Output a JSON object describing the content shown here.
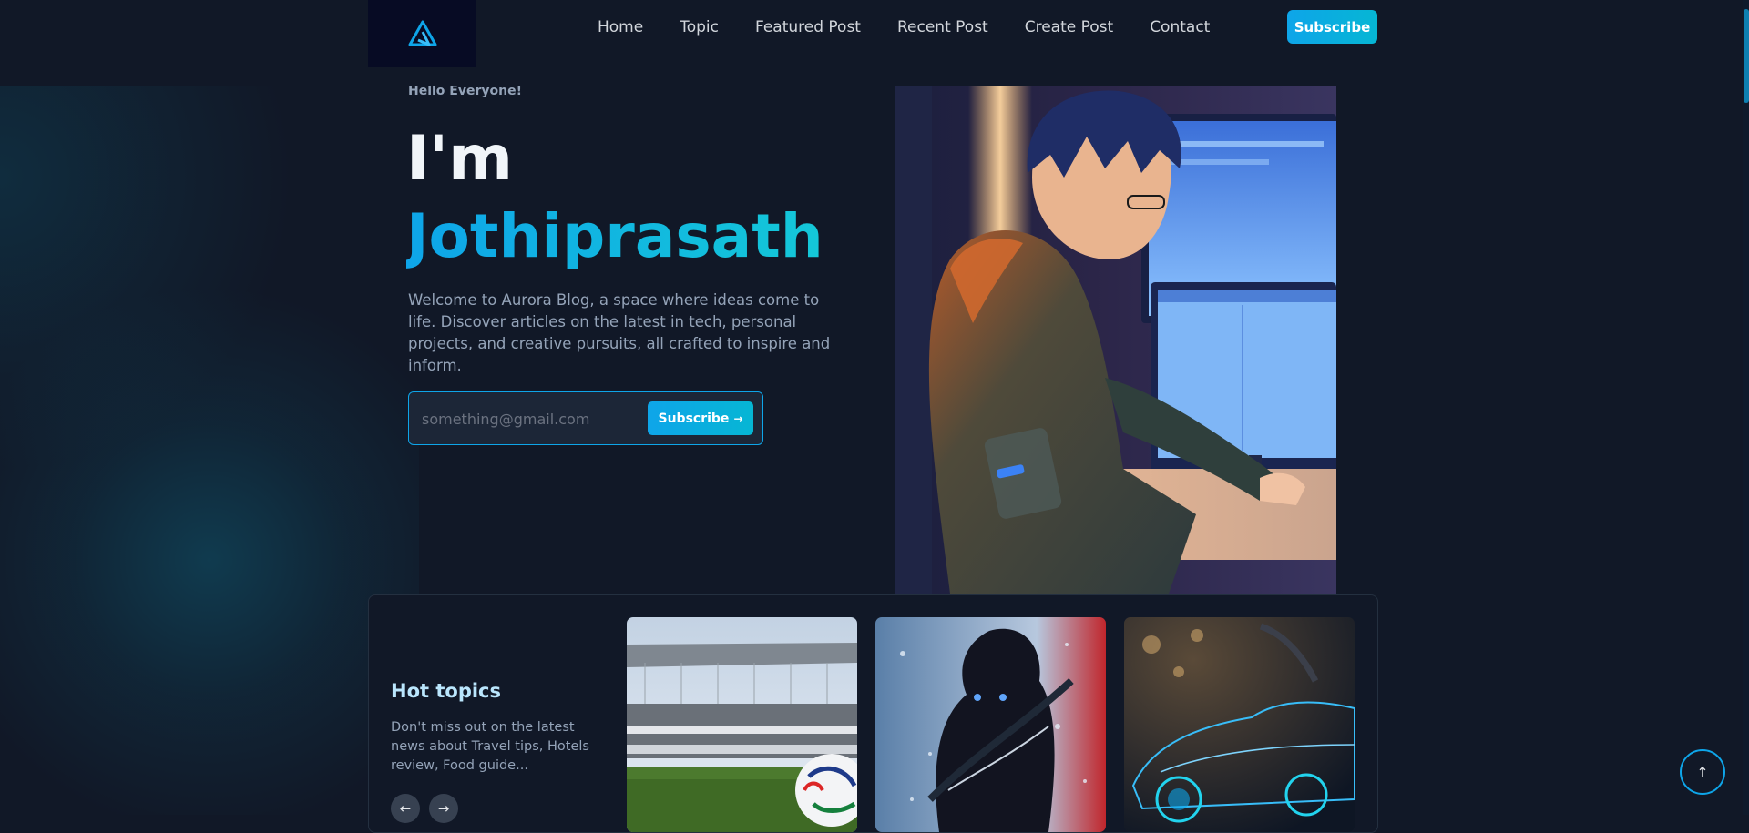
{
  "nav": {
    "items": [
      "Home",
      "Topic",
      "Featured Post",
      "Recent Post",
      "Create Post",
      "Contact"
    ],
    "subscribe_label": "Subscribe"
  },
  "hero": {
    "greeting": "Hello Everyone!",
    "intro": "I'm",
    "name": "Jothiprasath",
    "description": "Welcome to Aurora Blog, a space where ideas come to life. Discover articles on the latest in tech, personal projects, and creative pursuits, all crafted to inspire and inform.",
    "email_placeholder": "something@gmail.com",
    "subscribe_label": "Subscribe",
    "subscribe_arrow": "→"
  },
  "hot_topics": {
    "title": "Hot topics",
    "description": "Don't miss out on the latest news about Travel tips, Hotels review, Food guide...",
    "prev_icon": "←",
    "next_icon": "→"
  },
  "back_to_top_icon": "↑",
  "colors": {
    "background": "#111827",
    "accent": "#0ea5e9",
    "accent_alt": "#06b6d4",
    "heading": "#f1f5f9",
    "muted": "#94a3b8"
  }
}
